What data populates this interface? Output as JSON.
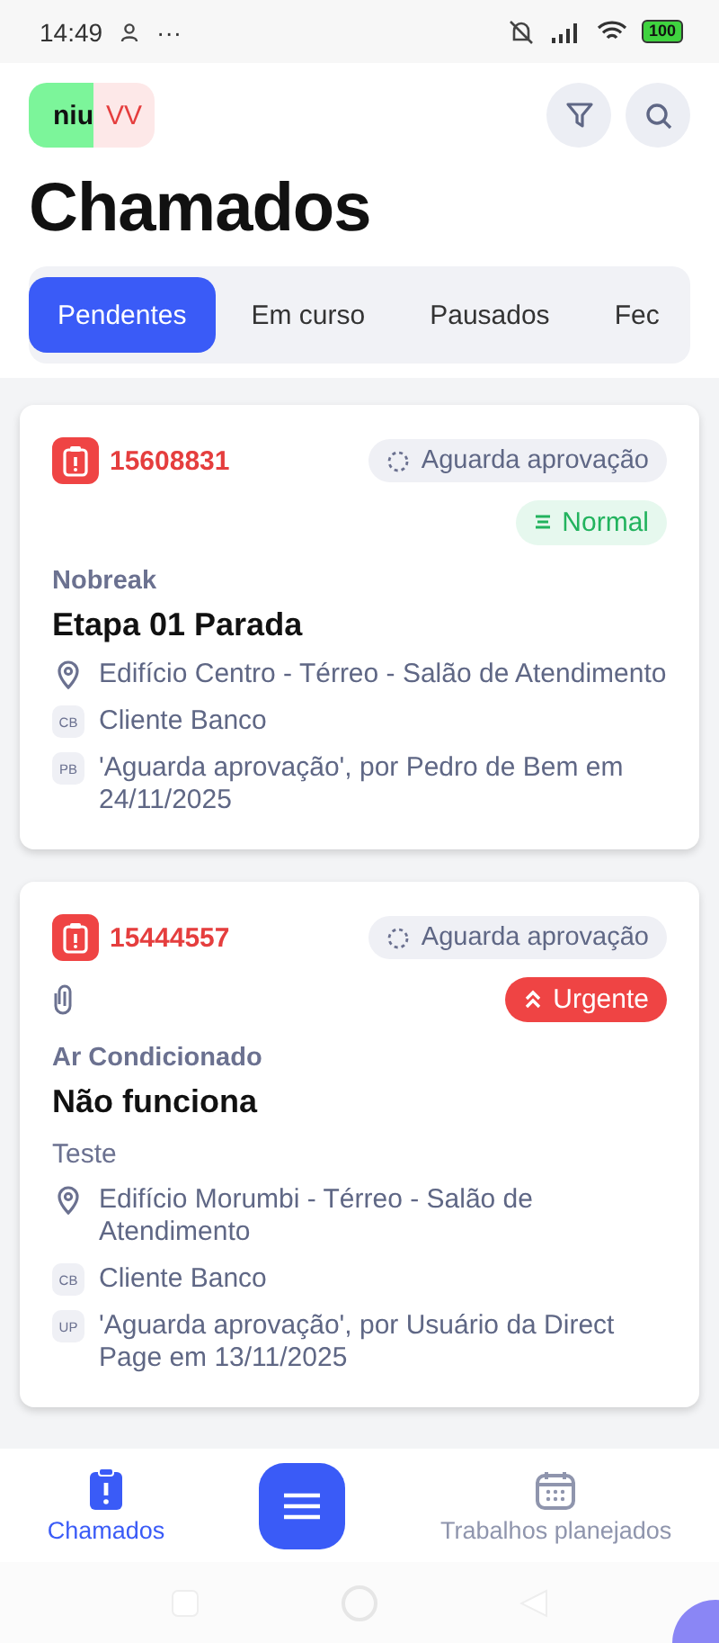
{
  "status_bar": {
    "time": "14:49",
    "more": "···",
    "battery": "100"
  },
  "header": {
    "logo_text": "niu",
    "avatar": "VV",
    "title": "Chamados"
  },
  "tabs": [
    {
      "label": "Pendentes",
      "selected": true
    },
    {
      "label": "Em curso",
      "selected": false
    },
    {
      "label": "Pausados",
      "selected": false
    },
    {
      "label": "Fec",
      "selected": false
    }
  ],
  "tickets": [
    {
      "number": "15608831",
      "status": "Aguarda aprovação",
      "attachment": false,
      "priority": {
        "label": "Normal",
        "kind": "normal"
      },
      "category": "Nobreak",
      "title": "Etapa 01 Parada",
      "details": [
        {
          "kind": "location",
          "text": "Edifício Centro - Térreo - Salão de Atendimento"
        },
        {
          "kind": "initials",
          "badge": "CB",
          "text": "Cliente Banco"
        },
        {
          "kind": "initials",
          "badge": "PB",
          "text": "'Aguarda aprovação', por Pedro de Bem em 24/11/2025"
        }
      ]
    },
    {
      "number": "15444557",
      "status": "Aguarda aprovação",
      "attachment": true,
      "priority": {
        "label": "Urgente",
        "kind": "urgent"
      },
      "category": "Ar Condicionado",
      "title": "Não funciona",
      "description": "Teste",
      "details": [
        {
          "kind": "location",
          "text": "Edifício Morumbi - Térreo - Salão de Atendimento"
        },
        {
          "kind": "initials",
          "badge": "CB",
          "text": "Cliente Banco"
        },
        {
          "kind": "initials",
          "badge": "UP",
          "text": "'Aguarda aprovação', por Usuário da Direct Page em 13/11/2025"
        }
      ]
    }
  ],
  "bottom_nav": [
    {
      "label": "Chamados",
      "kind": "tickets",
      "selected": true
    },
    {
      "kind": "menu"
    },
    {
      "label": "Trabalhos planejados",
      "kind": "calendar",
      "selected": false
    }
  ]
}
